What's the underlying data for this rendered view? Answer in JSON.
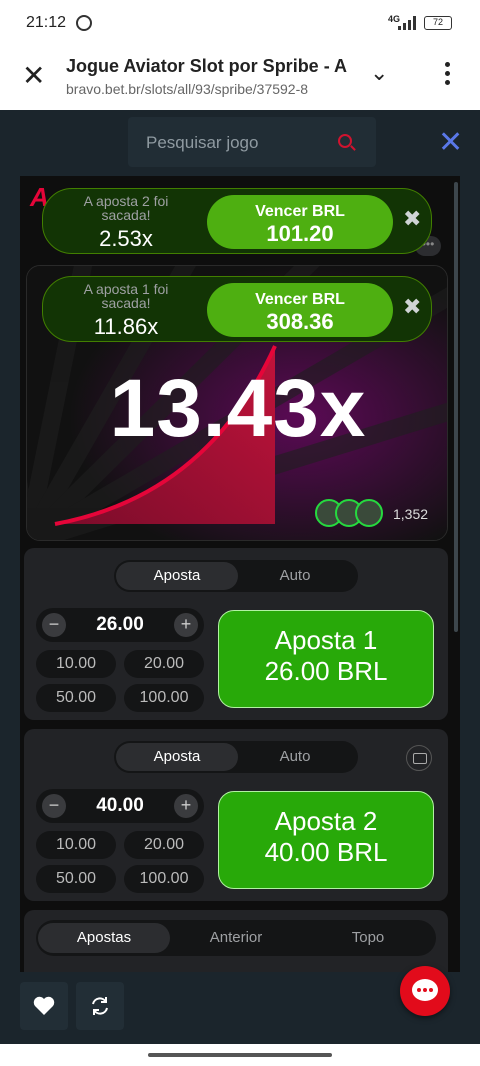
{
  "status_bar": {
    "time": "21:12",
    "network": "4G",
    "battery": "72"
  },
  "browser": {
    "title": "Jogue Aviator Slot por Spribe - A",
    "url": "bravo.bet.br/slots/all/93/spribe/37592-8"
  },
  "search": {
    "placeholder": "Pesquisar jogo"
  },
  "game": {
    "logo": "A",
    "multiplier": "13.43x",
    "players_count": "1,352"
  },
  "toasts": [
    {
      "message": "A aposta 2 foi sacada!",
      "multiplier": "2.53x",
      "win_label": "Vencer BRL",
      "win_amount": "101.20"
    },
    {
      "message": "A aposta 1 foi sacada!",
      "multiplier": "11.86x",
      "win_label": "Vencer BRL",
      "win_amount": "308.36"
    }
  ],
  "bet_panels": [
    {
      "tabs": [
        "Aposta",
        "Auto"
      ],
      "active_tab": "Aposta",
      "amount": "26.00",
      "quick_amounts": [
        "10.00",
        "20.00",
        "50.00",
        "100.00"
      ],
      "button_line1": "Aposta 1",
      "button_line2": "26.00 BRL"
    },
    {
      "tabs": [
        "Aposta",
        "Auto"
      ],
      "active_tab": "Aposta",
      "amount": "40.00",
      "quick_amounts": [
        "10.00",
        "20.00",
        "50.00",
        "100.00"
      ],
      "button_line1": "Aposta 2",
      "button_line2": "40.00 BRL"
    }
  ],
  "list_tabs": [
    "Apostas",
    "Anterior",
    "Topo"
  ],
  "colors": {
    "accent_red": "#e50539",
    "win_green": "#28a909",
    "background": "#1b252c"
  }
}
